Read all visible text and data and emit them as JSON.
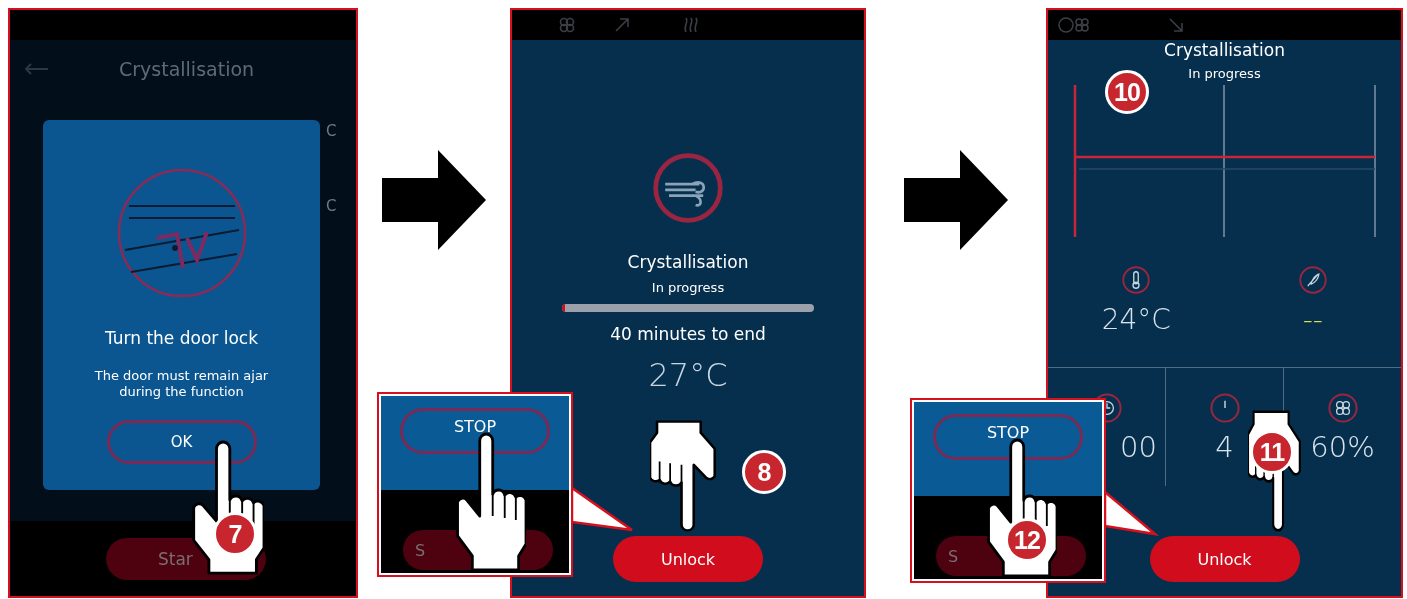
{
  "screens": [
    {
      "kind": "dialog",
      "title": "Crystallisation",
      "background_fragments": [
        "C",
        "C"
      ],
      "dialog": {
        "heading": "Turn the door lock",
        "message": "The door must remain ajar during the function",
        "button": "OK"
      },
      "start_button": "Star",
      "step": "7"
    },
    {
      "kind": "progress",
      "title": "Crystallisation",
      "status": "In progress",
      "progress": {
        "level": 0.01
      },
      "remaining": "40 minutes to end",
      "temperature": "27°C",
      "unlock_button": "Unlock",
      "step": "8",
      "inset": {
        "stop_button": "STOP",
        "start_button": "S"
      }
    },
    {
      "kind": "monitor",
      "title": "Crystallisation",
      "status": "In progress",
      "chart_step": "10",
      "readings": [
        {
          "kind": "temperature",
          "value": "24°C"
        },
        {
          "kind": "humidity",
          "value": "--"
        }
      ],
      "settings": [
        {
          "kind": "timer",
          "value": "00"
        },
        {
          "kind": "power",
          "value": "4"
        },
        {
          "kind": "fan",
          "value": "60%"
        }
      ],
      "unlock_button": "Unlock",
      "step": "11",
      "inset": {
        "stop_button": "STOP",
        "start_button": "S",
        "step": "12"
      }
    }
  ]
}
